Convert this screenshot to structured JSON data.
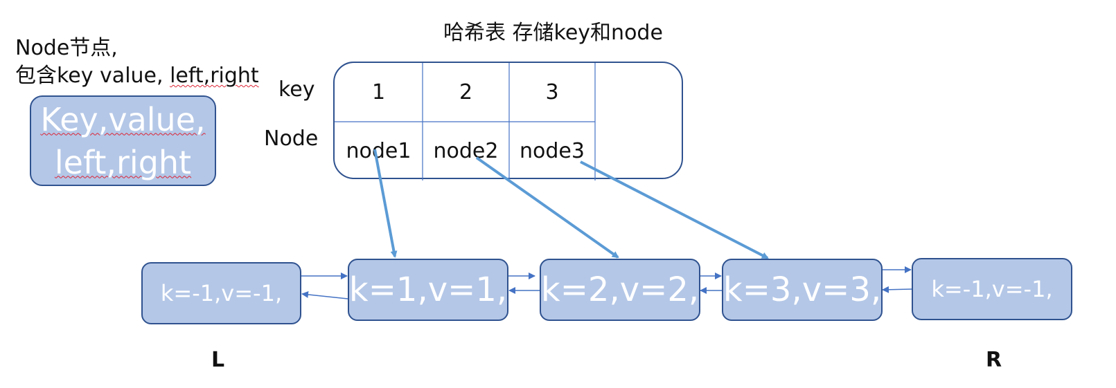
{
  "title": "哈希表 存储key和node",
  "node_description": {
    "line1": "Node节点,",
    "line2_a": "包含key value, ",
    "line2_b": "left,right"
  },
  "legend_box": {
    "line1": "Key,value,",
    "line2": "left,right"
  },
  "hash_table": {
    "row_labels": {
      "key": "key",
      "node": "Node"
    },
    "keys": [
      "1",
      "2",
      "3"
    ],
    "nodes": [
      "node1",
      "node2",
      "node3"
    ]
  },
  "linked_list": {
    "head_label": "L",
    "tail_label": "R",
    "nodes": [
      "k=-1,v=-1,",
      "k=1,v=1,",
      "k=2,v=2,",
      "k=3,v=3,",
      "k=-1,v=-1,"
    ]
  },
  "colors": {
    "node_fill": "#b4c7e7",
    "node_border": "#2f528f",
    "arrow": "#5b9bd5",
    "list_arrow": "#4472c4"
  }
}
